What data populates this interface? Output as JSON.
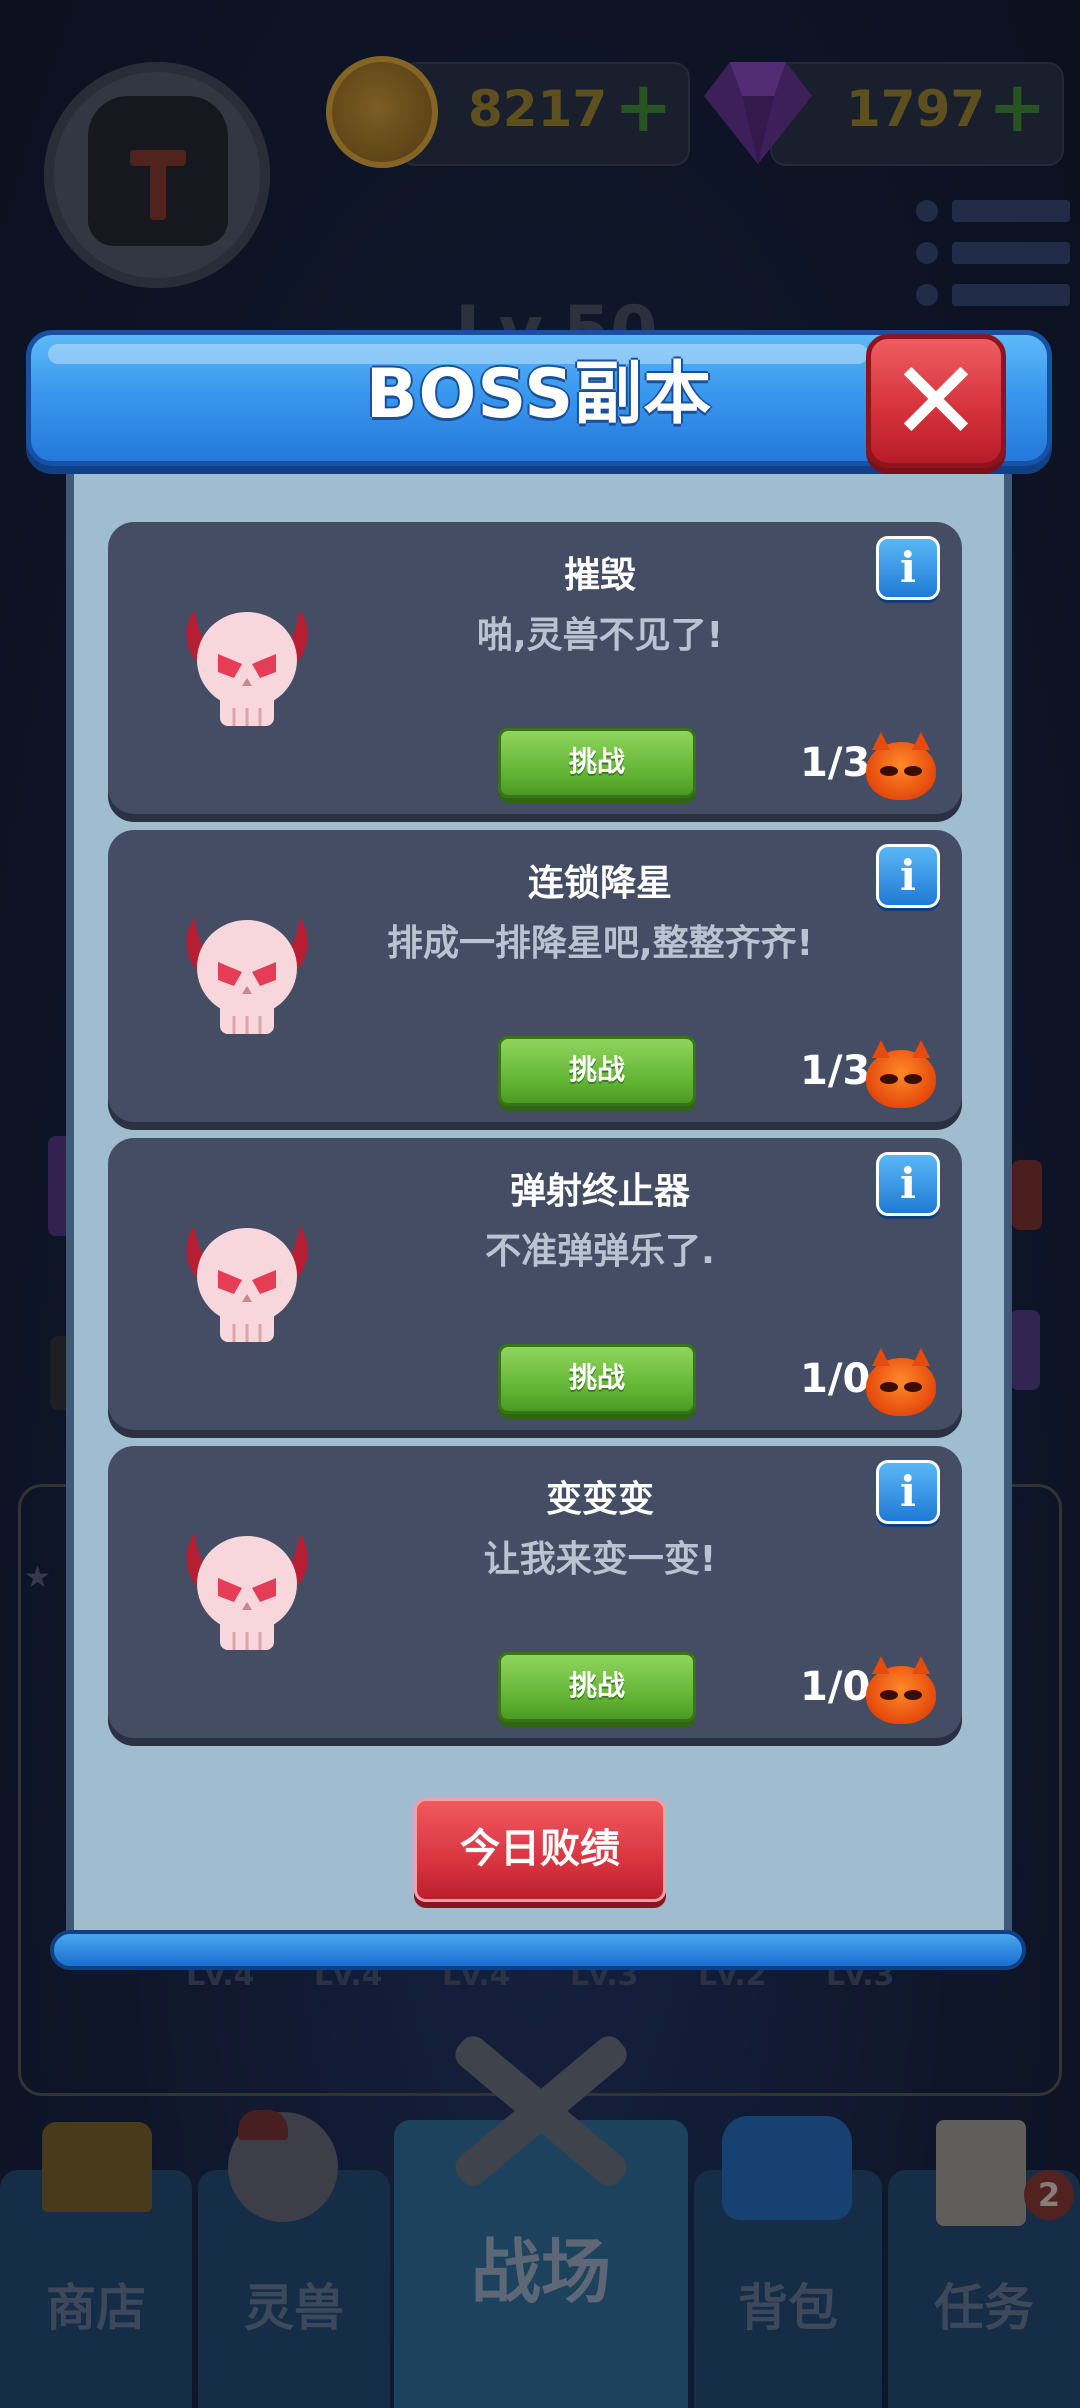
{
  "resources": {
    "coins": "8217",
    "gems": "1797",
    "add": "+"
  },
  "background": {
    "level_label": "Lv.50",
    "slot_levels": [
      "Lv.4",
      "Lv.4",
      "Lv.4",
      "Lv.3",
      "Lv.2",
      "Lv.3"
    ]
  },
  "dialog": {
    "title": "BOSS副本",
    "close": "✕",
    "info": "i",
    "challenge_label": "挑战",
    "cards": [
      {
        "name": "摧毁",
        "desc": "啪,灵兽不见了!",
        "count": "1/3"
      },
      {
        "name": "连锁降星",
        "desc": "排成一排降星吧,整整齐齐!",
        "count": "1/3"
      },
      {
        "name": "弹射终止器",
        "desc": "不准弹弹乐了.",
        "count": "1/0"
      },
      {
        "name": "变变变",
        "desc": "让我来变一变!",
        "count": "1/0"
      }
    ],
    "defeat_record_label": "今日败绩"
  },
  "nav": {
    "tabs": [
      {
        "label": "商店"
      },
      {
        "label": "灵兽"
      },
      {
        "label": "战场"
      },
      {
        "label": "背包"
      },
      {
        "label": "任务"
      }
    ],
    "task_badge": "2"
  },
  "colors": {
    "header_blue": "#3a98ee",
    "close_red": "#d4303a",
    "card_bg": "#454d64",
    "challenge_green": "#5fb232",
    "defeat_red": "#d42f3c"
  }
}
